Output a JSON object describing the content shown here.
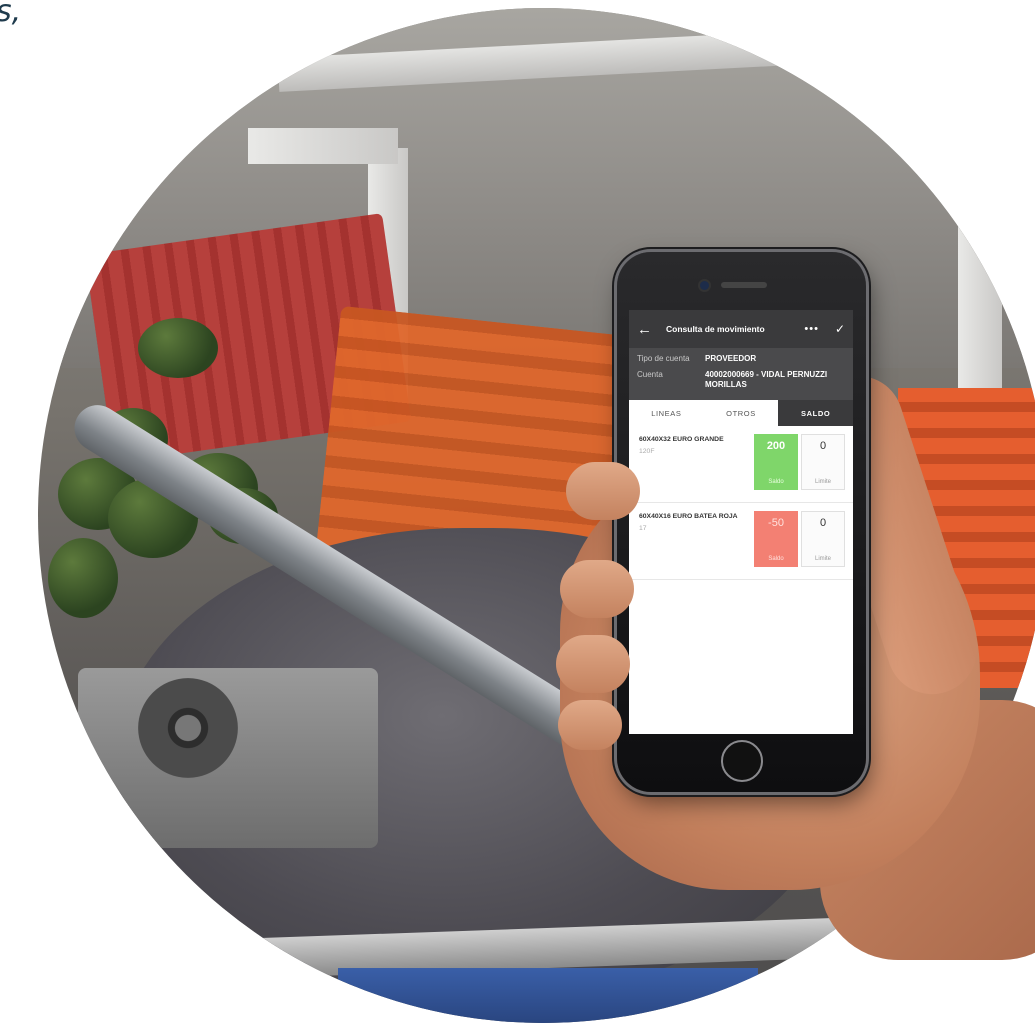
{
  "corner_text": "s,",
  "app": {
    "title": "Consulta de movimiento",
    "more_icon": "•••",
    "check_icon": "✓",
    "back_icon": "←"
  },
  "info": {
    "tipo_label": "Tipo de cuenta",
    "tipo_value": "PROVEEDOR",
    "cuenta_label": "Cuenta",
    "cuenta_value": "40002000669 - VIDAL PERNUZZI MORILLAS"
  },
  "tabs": [
    "LINEAS",
    "OTROS",
    "SALDO"
  ],
  "items": [
    {
      "name": "60X40X32 EURO GRANDE",
      "sub": "120F",
      "saldo": "200",
      "saldo_label": "Saldo",
      "limite": "0",
      "limite_label": "Limite"
    },
    {
      "name": "60X40X16 EURO BATEA ROJA",
      "sub": "17",
      "saldo": "-50",
      "saldo_label": "Saldo",
      "limite": "0",
      "limite_label": "Limite"
    }
  ],
  "colors": {
    "positive": "#7fd66a",
    "negative": "#f38073",
    "appbar": "#3a3a3c"
  }
}
